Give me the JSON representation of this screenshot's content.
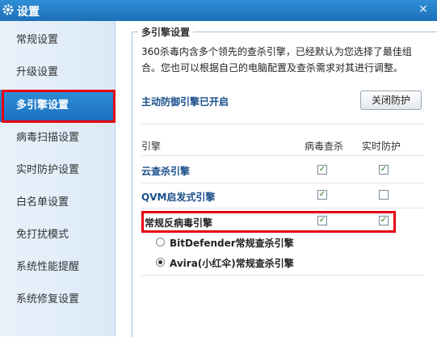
{
  "window": {
    "title": "设置",
    "close_glyph": "✕"
  },
  "sidebar": {
    "items": [
      {
        "label": "常规设置"
      },
      {
        "label": "升级设置"
      },
      {
        "label": "多引擎设置"
      },
      {
        "label": "病毒扫描设置"
      },
      {
        "label": "实时防护设置"
      },
      {
        "label": "白名单设置"
      },
      {
        "label": "免打扰模式"
      },
      {
        "label": "系统性能提醒"
      },
      {
        "label": "系统修复设置"
      }
    ],
    "active_index": 2
  },
  "panel": {
    "group_title": "多引擎设置",
    "desc_line1": "360杀毒内含多个领先的查杀引擎，已经默认为您选择了最佳组",
    "desc_line2": "合。您也可以根据自己的电脑配置及查杀需求对其进行调整。",
    "guard_status": "主动防御引擎已开启",
    "close_guard_button": "关闭防护",
    "table": {
      "headers": {
        "engine": "引擎",
        "virus_scan": "病毒查杀",
        "realtime": "实时防护"
      },
      "rows": [
        {
          "label": "云查杀引擎",
          "virus_scan": true,
          "realtime": true
        },
        {
          "label": "QVM启发式引擎",
          "virus_scan": true,
          "realtime": false
        },
        {
          "label": "常规反病毒引擎",
          "virus_scan": true,
          "realtime": true
        }
      ]
    },
    "engine_options": [
      {
        "label": "BitDefender常规查杀引擎",
        "selected": false
      },
      {
        "label": "Avira(小红伞)常规查杀引擎",
        "selected": true
      }
    ]
  }
}
